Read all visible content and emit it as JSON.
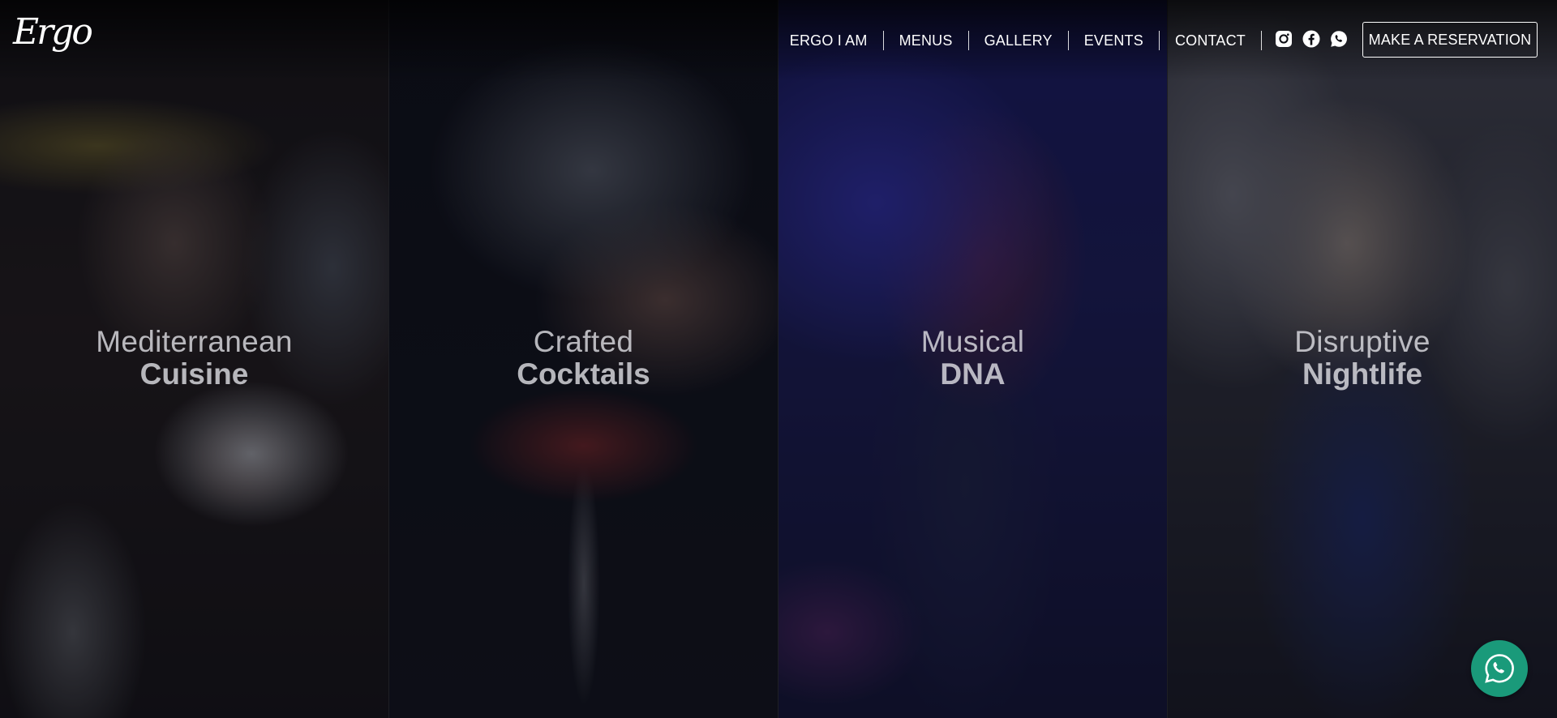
{
  "brand": {
    "logo_text": "Ergo"
  },
  "nav": {
    "items": [
      {
        "label": "ERGO I AM"
      },
      {
        "label": "MENUS"
      },
      {
        "label": "GALLERY"
      },
      {
        "label": "EVENTS"
      },
      {
        "label": "CONTACT"
      }
    ],
    "social_icons": [
      "instagram-icon",
      "facebook-icon",
      "whatsapp-icon"
    ],
    "reserve_label": "MAKE A RESERVATION"
  },
  "panels": [
    {
      "light": "Mediterranean",
      "bold": "Cuisine"
    },
    {
      "light": "Crafted",
      "bold": "Cocktails"
    },
    {
      "light": "Musical",
      "bold": "DNA"
    },
    {
      "light": "Disruptive",
      "bold": "Nightlife"
    }
  ],
  "colors": {
    "whatsapp_float": "#1a9a7a",
    "header_text": "#ffffff"
  }
}
